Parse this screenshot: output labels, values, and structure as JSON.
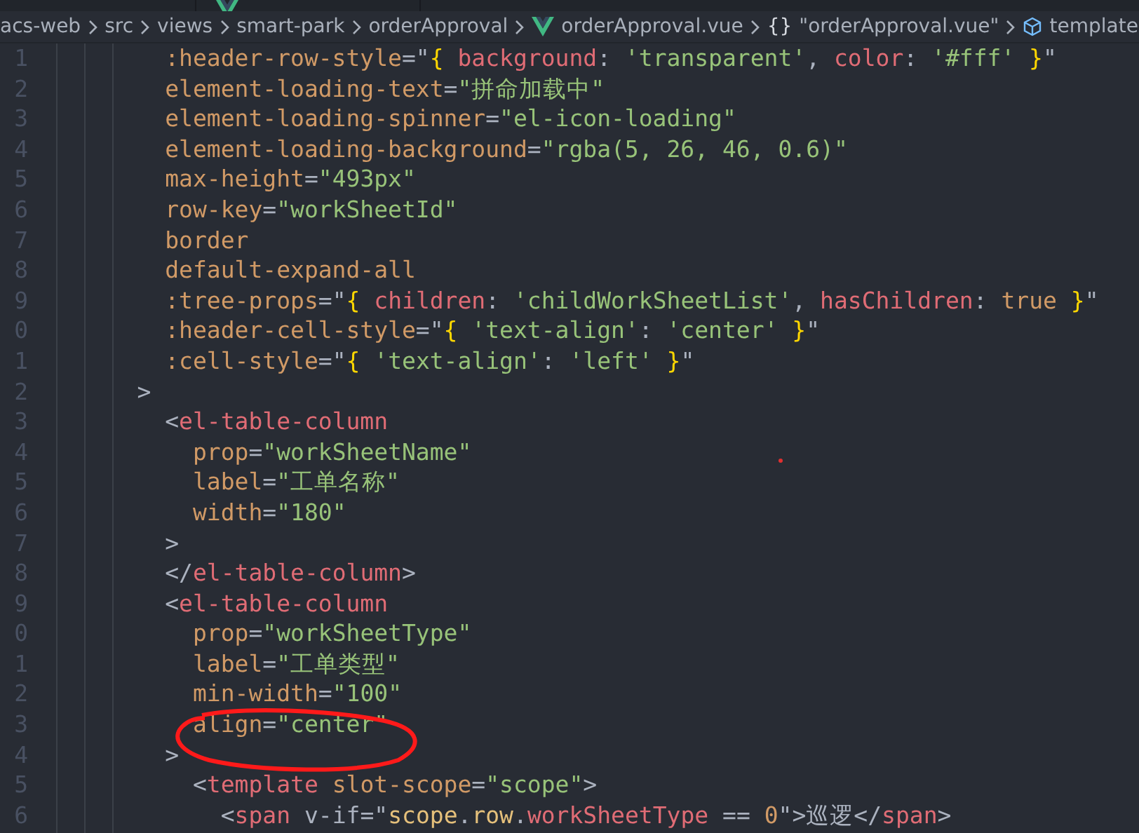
{
  "tabs": [
    {
      "kind": "plain"
    },
    {
      "kind": "vue"
    }
  ],
  "breadcrumbs": [
    {
      "kind": "folder",
      "label": "acs-web"
    },
    {
      "kind": "folder",
      "label": "src"
    },
    {
      "kind": "folder",
      "label": "views"
    },
    {
      "kind": "folder",
      "label": "smart-park"
    },
    {
      "kind": "folder",
      "label": "orderApproval"
    },
    {
      "kind": "vue",
      "label": "orderApproval.vue"
    },
    {
      "kind": "object",
      "icon": "{}",
      "label": "\"orderApproval.vue\""
    },
    {
      "kind": "symbol",
      "label": "template"
    }
  ],
  "lines": [
    {
      "number": "1",
      "tokens": [
        {
          "kind": "attr",
          "t": "      :header-row-style"
        },
        {
          "kind": "p",
          "t": "=\""
        },
        {
          "kind": "brace",
          "t": "{"
        },
        {
          "kind": "key",
          "t": " background"
        },
        {
          "kind": "p",
          "t": ": "
        },
        {
          "kind": "str",
          "t": "'transparent'"
        },
        {
          "kind": "p",
          "t": ", "
        },
        {
          "kind": "key",
          "t": "color"
        },
        {
          "kind": "p",
          "t": ": "
        },
        {
          "kind": "str",
          "t": "'#fff'"
        },
        {
          "kind": "brace",
          "t": " }"
        },
        {
          "kind": "p",
          "t": "\""
        }
      ]
    },
    {
      "number": "2",
      "tokens": [
        {
          "kind": "attr",
          "t": "      element-loading-text"
        },
        {
          "kind": "p",
          "t": "="
        },
        {
          "kind": "str",
          "t": "\"拼命加载中\""
        }
      ]
    },
    {
      "number": "3",
      "tokens": [
        {
          "kind": "attr",
          "t": "      element-loading-spinner"
        },
        {
          "kind": "p",
          "t": "="
        },
        {
          "kind": "str",
          "t": "\"el-icon-loading\""
        }
      ]
    },
    {
      "number": "4",
      "tokens": [
        {
          "kind": "attr",
          "t": "      element-loading-background"
        },
        {
          "kind": "p",
          "t": "="
        },
        {
          "kind": "str",
          "t": "\"rgba(5, 26, 46, 0.6)\""
        }
      ]
    },
    {
      "number": "5",
      "tokens": [
        {
          "kind": "attr",
          "t": "      max-height"
        },
        {
          "kind": "p",
          "t": "="
        },
        {
          "kind": "str",
          "t": "\"493px\""
        }
      ]
    },
    {
      "number": "6",
      "tokens": [
        {
          "kind": "attr",
          "t": "      row-key"
        },
        {
          "kind": "p",
          "t": "="
        },
        {
          "kind": "str",
          "t": "\"workSheetId\""
        }
      ]
    },
    {
      "number": "7",
      "tokens": [
        {
          "kind": "attr",
          "t": "      border"
        }
      ]
    },
    {
      "number": "8",
      "tokens": [
        {
          "kind": "attr",
          "t": "      default-expand-all"
        }
      ]
    },
    {
      "number": "9",
      "tokens": [
        {
          "kind": "attr",
          "t": "      :tree-props"
        },
        {
          "kind": "p",
          "t": "=\""
        },
        {
          "kind": "brace",
          "t": "{"
        },
        {
          "kind": "key",
          "t": " children"
        },
        {
          "kind": "p",
          "t": ": "
        },
        {
          "kind": "str",
          "t": "'childWorkSheetList'"
        },
        {
          "kind": "p",
          "t": ", "
        },
        {
          "kind": "key",
          "t": "hasChildren"
        },
        {
          "kind": "p",
          "t": ": "
        },
        {
          "kind": "bool",
          "t": "true"
        },
        {
          "kind": "brace",
          "t": " }"
        },
        {
          "kind": "p",
          "t": "\""
        }
      ]
    },
    {
      "number": "0",
      "tokens": [
        {
          "kind": "attr",
          "t": "      :header-cell-style"
        },
        {
          "kind": "p",
          "t": "=\""
        },
        {
          "kind": "brace",
          "t": "{"
        },
        {
          "kind": "str",
          "t": " 'text-align'"
        },
        {
          "kind": "p",
          "t": ": "
        },
        {
          "kind": "str",
          "t": "'center'"
        },
        {
          "kind": "brace",
          "t": " }"
        },
        {
          "kind": "p",
          "t": "\""
        }
      ]
    },
    {
      "number": "1",
      "tokens": [
        {
          "kind": "attr",
          "t": "      :cell-style"
        },
        {
          "kind": "p",
          "t": "=\""
        },
        {
          "kind": "brace",
          "t": "{"
        },
        {
          "kind": "str",
          "t": " 'text-align'"
        },
        {
          "kind": "p",
          "t": ": "
        },
        {
          "kind": "str",
          "t": "'left'"
        },
        {
          "kind": "brace",
          "t": " }"
        },
        {
          "kind": "p",
          "t": "\""
        }
      ]
    },
    {
      "number": "2",
      "tokens": [
        {
          "kind": "p",
          "t": "    >"
        }
      ]
    },
    {
      "number": "3",
      "tokens": [
        {
          "kind": "p",
          "t": "      <"
        },
        {
          "kind": "tag",
          "t": "el-table-column"
        }
      ]
    },
    {
      "number": "4",
      "tokens": [
        {
          "kind": "attr",
          "t": "        prop"
        },
        {
          "kind": "p",
          "t": "="
        },
        {
          "kind": "str",
          "t": "\"workSheetName\""
        }
      ]
    },
    {
      "number": "5",
      "tokens": [
        {
          "kind": "attr",
          "t": "        label"
        },
        {
          "kind": "p",
          "t": "="
        },
        {
          "kind": "str",
          "t": "\"工单名称\""
        }
      ]
    },
    {
      "number": "6",
      "tokens": [
        {
          "kind": "attr",
          "t": "        width"
        },
        {
          "kind": "p",
          "t": "="
        },
        {
          "kind": "str",
          "t": "\"180\""
        }
      ]
    },
    {
      "number": "7",
      "tokens": [
        {
          "kind": "p",
          "t": "      >"
        }
      ]
    },
    {
      "number": "8",
      "tokens": [
        {
          "kind": "p",
          "t": "      </"
        },
        {
          "kind": "tag",
          "t": "el-table-column"
        },
        {
          "kind": "p",
          "t": ">"
        }
      ]
    },
    {
      "number": "9",
      "tokens": [
        {
          "kind": "p",
          "t": "      <"
        },
        {
          "kind": "tag",
          "t": "el-table-column"
        }
      ]
    },
    {
      "number": "0",
      "tokens": [
        {
          "kind": "attr",
          "t": "        prop"
        },
        {
          "kind": "p",
          "t": "="
        },
        {
          "kind": "str",
          "t": "\"workSheetType\""
        }
      ]
    },
    {
      "number": "1",
      "tokens": [
        {
          "kind": "attr",
          "t": "        label"
        },
        {
          "kind": "p",
          "t": "="
        },
        {
          "kind": "str",
          "t": "\"工单类型\""
        }
      ]
    },
    {
      "number": "2",
      "tokens": [
        {
          "kind": "attr",
          "t": "        min-width"
        },
        {
          "kind": "p",
          "t": "="
        },
        {
          "kind": "str",
          "t": "\"100\""
        }
      ]
    },
    {
      "number": "3",
      "tokens": [
        {
          "kind": "attr",
          "t": "        align"
        },
        {
          "kind": "p",
          "t": "="
        },
        {
          "kind": "str",
          "t": "\"center\""
        }
      ]
    },
    {
      "number": "4",
      "tokens": [
        {
          "kind": "p",
          "t": "      >"
        }
      ]
    },
    {
      "number": "5",
      "tokens": [
        {
          "kind": "p",
          "t": "        <"
        },
        {
          "kind": "tag",
          "t": "template"
        },
        {
          "kind": "attr",
          "t": " slot-scope"
        },
        {
          "kind": "p",
          "t": "="
        },
        {
          "kind": "str",
          "t": "\"scope\""
        },
        {
          "kind": "p",
          "t": ">"
        }
      ]
    },
    {
      "number": "6",
      "tokens": [
        {
          "kind": "p",
          "t": "          <"
        },
        {
          "kind": "tag",
          "t": "span"
        },
        {
          "kind": "p",
          "t": " v-if=\""
        },
        {
          "kind": "var",
          "t": "scope"
        },
        {
          "kind": "p",
          "t": "."
        },
        {
          "kind": "var",
          "t": "row"
        },
        {
          "kind": "p",
          "t": "."
        },
        {
          "kind": "key",
          "t": "workSheetType"
        },
        {
          "kind": "p",
          "t": " == "
        },
        {
          "kind": "bool",
          "t": "0"
        },
        {
          "kind": "p",
          "t": "\">巡逻</"
        },
        {
          "kind": "tag",
          "t": "span"
        },
        {
          "kind": "p",
          "t": ">"
        }
      ]
    }
  ]
}
